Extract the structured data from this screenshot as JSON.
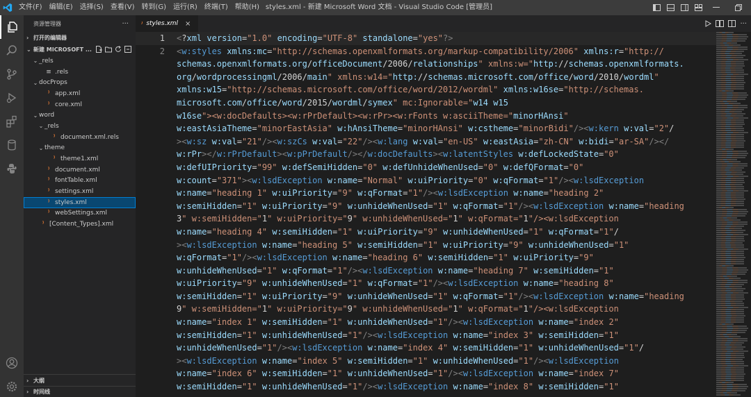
{
  "titlebar": {
    "menu": [
      "文件(F)",
      "编辑(E)",
      "选择(S)",
      "查看(V)",
      "转到(G)",
      "运行(R)",
      "终端(T)",
      "帮助(H)"
    ],
    "window_title": "styles.xml - 新建 Microsoft Word 文档 - Visual Studio Code [管理员]"
  },
  "sidebar": {
    "title": "资源管理器",
    "more": "···",
    "open_editors": "打开的编辑器",
    "project": "新建 MICROSOFT ...",
    "tree": [
      {
        "label": "_rels",
        "type": "folder",
        "level": 1,
        "expanded": true
      },
      {
        "label": ".rels",
        "type": "rels",
        "level": 2
      },
      {
        "label": "docProps",
        "type": "folder",
        "level": 1,
        "expanded": true
      },
      {
        "label": "app.xml",
        "type": "xml",
        "level": 2
      },
      {
        "label": "core.xml",
        "type": "xml",
        "level": 2
      },
      {
        "label": "word",
        "type": "folder",
        "level": 1,
        "expanded": true
      },
      {
        "label": "_rels",
        "type": "folder",
        "level": 2,
        "expanded": true
      },
      {
        "label": "document.xml.rels",
        "type": "xml",
        "level": 3
      },
      {
        "label": "theme",
        "type": "folder",
        "level": 2,
        "expanded": true
      },
      {
        "label": "theme1.xml",
        "type": "xml",
        "level": 3
      },
      {
        "label": "document.xml",
        "type": "xml",
        "level": 2
      },
      {
        "label": "fontTable.xml",
        "type": "xml",
        "level": 2
      },
      {
        "label": "settings.xml",
        "type": "xml",
        "level": 2
      },
      {
        "label": "styles.xml",
        "type": "xml",
        "level": 2,
        "selected": true
      },
      {
        "label": "webSettings.xml",
        "type": "xml",
        "level": 2
      },
      {
        "label": "[Content_Types].xml",
        "type": "xml",
        "level": 1
      }
    ],
    "outline": "大纲",
    "timeline": "时间线"
  },
  "editor": {
    "tab_label": "styles.xml",
    "tab_close": "×",
    "line_numbers": [
      "1",
      "2"
    ],
    "code_lines": [
      "<?xml version=\"1.0\" encoding=\"UTF-8\" standalone=\"yes\"?>",
      "<w:styles xmlns:mc=\"http://schemas.openxmlformats.org/markup-compatibility/2006\" xmlns:r=\"http://",
      "schemas.openxmlformats.org/officeDocument/2006/relationships\" xmlns:w=\"http://schemas.openxmlformats.",
      "org/wordprocessingml/2006/main\" xmlns:w14=\"http://schemas.microsoft.com/office/word/2010/wordml\"",
      "xmlns:w15=\"http://schemas.microsoft.com/office/word/2012/wordml\" xmlns:w16se=\"http://schemas.",
      "microsoft.com/office/word/2015/wordml/symex\" mc:Ignorable=\"w14 w15",
      "w16se\"><w:docDefaults><w:rPrDefault><w:rPr><w:rFonts w:asciiTheme=\"minorHAnsi\"",
      "w:eastAsiaTheme=\"minorEastAsia\" w:hAnsiTheme=\"minorHAnsi\" w:cstheme=\"minorBidi\"/><w:kern w:val=\"2\"/",
      "><w:sz w:val=\"21\"/><w:szCs w:val=\"22\"/><w:lang w:val=\"en-US\" w:eastAsia=\"zh-CN\" w:bidi=\"ar-SA\"/></",
      "w:rPr></w:rPrDefault><w:pPrDefault/></w:docDefaults><w:latentStyles w:defLockedState=\"0\"",
      "w:defUIPriority=\"99\" w:defSemiHidden=\"0\" w:defUnhideWhenUsed=\"0\" w:defQFormat=\"0\"",
      "w:count=\"371\"><w:lsdException w:name=\"Normal\" w:uiPriority=\"0\" w:qFormat=\"1\"/><w:lsdException",
      "w:name=\"heading 1\" w:uiPriority=\"9\" w:qFormat=\"1\"/><w:lsdException w:name=\"heading 2\"",
      "w:semiHidden=\"1\" w:uiPriority=\"9\" w:unhideWhenUsed=\"1\" w:qFormat=\"1\"/><w:lsdException w:name=\"heading",
      "3\" w:semiHidden=\"1\" w:uiPriority=\"9\" w:unhideWhenUsed=\"1\" w:qFormat=\"1\"/><w:lsdException",
      "w:name=\"heading 4\" w:semiHidden=\"1\" w:uiPriority=\"9\" w:unhideWhenUsed=\"1\" w:qFormat=\"1\"/",
      "><w:lsdException w:name=\"heading 5\" w:semiHidden=\"1\" w:uiPriority=\"9\" w:unhideWhenUsed=\"1\"",
      "w:qFormat=\"1\"/><w:lsdException w:name=\"heading 6\" w:semiHidden=\"1\" w:uiPriority=\"9\"",
      "w:unhideWhenUsed=\"1\" w:qFormat=\"1\"/><w:lsdException w:name=\"heading 7\" w:semiHidden=\"1\"",
      "w:uiPriority=\"9\" w:unhideWhenUsed=\"1\" w:qFormat=\"1\"/><w:lsdException w:name=\"heading 8\"",
      "w:semiHidden=\"1\" w:uiPriority=\"9\" w:unhideWhenUsed=\"1\" w:qFormat=\"1\"/><w:lsdException w:name=\"heading",
      "9\" w:semiHidden=\"1\" w:uiPriority=\"9\" w:unhideWhenUsed=\"1\" w:qFormat=\"1\"/><w:lsdException",
      "w:name=\"index 1\" w:semiHidden=\"1\" w:unhideWhenUsed=\"1\"/><w:lsdException w:name=\"index 2\"",
      "w:semiHidden=\"1\" w:unhideWhenUsed=\"1\"/><w:lsdException w:name=\"index 3\" w:semiHidden=\"1\"",
      "w:unhideWhenUsed=\"1\"/><w:lsdException w:name=\"index 4\" w:semiHidden=\"1\" w:unhideWhenUsed=\"1\"/",
      "><w:lsdException w:name=\"index 5\" w:semiHidden=\"1\" w:unhideWhenUsed=\"1\"/><w:lsdException",
      "w:name=\"index 6\" w:semiHidden=\"1\" w:unhideWhenUsed=\"1\"/><w:lsdException w:name=\"index 7\"",
      "w:semiHidden=\"1\" w:unhideWhenUsed=\"1\"/><w:lsdException w:name=\"index 8\" w:semiHidden=\"1\""
    ]
  },
  "colors": {
    "accent": "#007acc",
    "tag": "#569cd6",
    "attr": "#9cdcfe",
    "string": "#ce9178",
    "punct": "#808080",
    "selection": "#094771"
  }
}
